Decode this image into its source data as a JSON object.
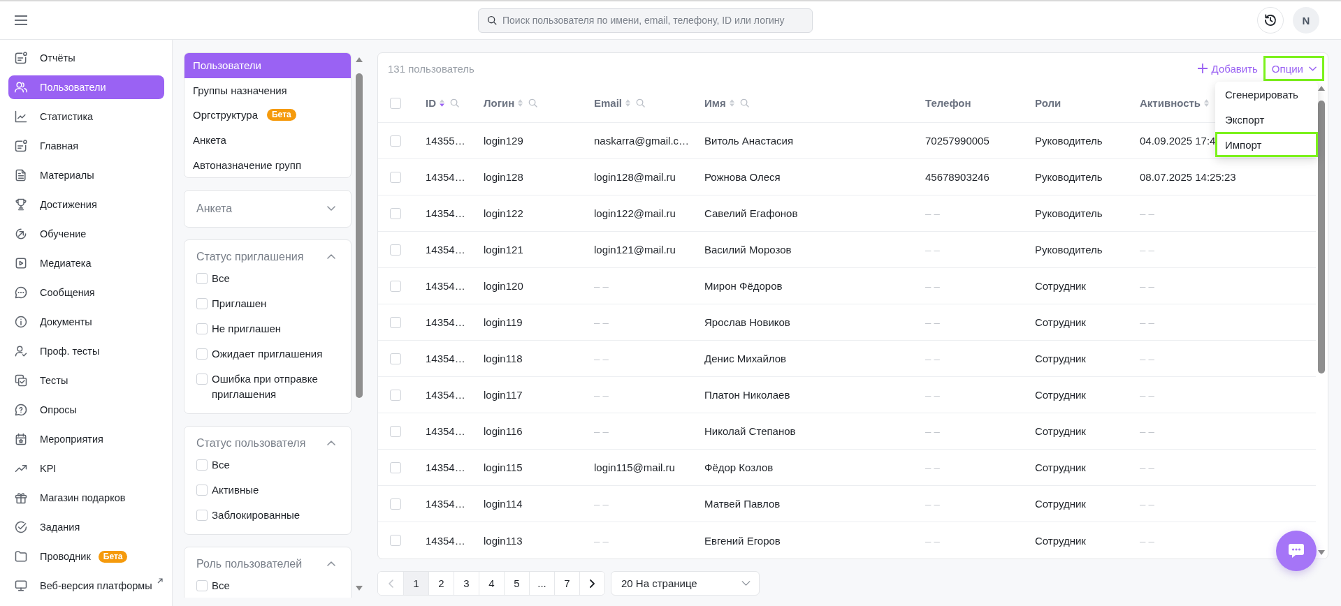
{
  "topbar": {
    "search": {
      "placeholder": "Поиск пользователя по имени, email, телефону, ID или логину"
    },
    "avatar": "N"
  },
  "sidebar": {
    "items": [
      {
        "label": "Отчёты",
        "selected": false
      },
      {
        "label": "Пользователи",
        "selected": true
      },
      {
        "label": "Статистика",
        "selected": false
      },
      {
        "label": "Главная",
        "selected": false
      },
      {
        "label": "Материалы",
        "selected": false
      },
      {
        "label": "Достижения",
        "selected": false
      },
      {
        "label": "Обучение",
        "selected": false
      },
      {
        "label": "Медиатека",
        "selected": false
      },
      {
        "label": "Сообщения",
        "selected": false
      },
      {
        "label": "Документы",
        "selected": false
      },
      {
        "label": "Проф. тесты",
        "selected": false
      },
      {
        "label": "Тесты",
        "selected": false
      },
      {
        "label": "Опросы",
        "selected": false
      },
      {
        "label": "Мероприятия",
        "selected": false
      },
      {
        "label": "KPI",
        "selected": false
      },
      {
        "label": "Магазин подарков",
        "selected": false
      },
      {
        "label": "Задания",
        "selected": false
      },
      {
        "label": "Проводник",
        "selected": false,
        "badge": "Бета"
      },
      {
        "label": "Веб-версия платформы",
        "selected": false,
        "external": true
      }
    ]
  },
  "sections_nav": {
    "items": [
      {
        "label": "Пользователи",
        "selected": true
      },
      {
        "label": "Группы назначения",
        "selected": false
      },
      {
        "label": "Оргструктура",
        "selected": false,
        "badge": "Бета"
      },
      {
        "label": "Анкета",
        "selected": false
      },
      {
        "label": "Автоназначение групп",
        "selected": false
      }
    ]
  },
  "filters": [
    {
      "title": "Анкета",
      "expanded": false
    },
    {
      "title": "Статус приглашения",
      "expanded": true,
      "options": [
        {
          "label": "Все",
          "checked": false
        },
        {
          "label": "Приглашен",
          "checked": false
        },
        {
          "label": "Не приглашен",
          "checked": false
        },
        {
          "label": "Ожидает приглашения",
          "checked": false
        },
        {
          "label": "Ошибка при отправке приглашения",
          "checked": false
        }
      ]
    },
    {
      "title": "Статус пользователя",
      "expanded": true,
      "options": [
        {
          "label": "Все",
          "checked": false
        },
        {
          "label": "Активные",
          "checked": false
        },
        {
          "label": "Заблокированные",
          "checked": false
        }
      ]
    },
    {
      "title": "Роль пользователей",
      "expanded": true,
      "options": [
        {
          "label": "Все",
          "checked": false
        }
      ]
    }
  ],
  "table": {
    "count": "131 пользователь",
    "actions": {
      "add": "Добавить",
      "options": {
        "label": "Опции",
        "highlighted": true,
        "open": true,
        "menu": [
          {
            "label": "Сгенерировать",
            "highlighted": false
          },
          {
            "label": "Экспорт",
            "highlighted": false
          },
          {
            "label": "Импорт",
            "highlighted": true
          }
        ]
      }
    },
    "select_all": {
      "checked": false
    },
    "columns": [
      {
        "label": "ID",
        "sortable": true,
        "sorted": true,
        "search": true
      },
      {
        "label": "Логин",
        "sortable": true,
        "sorted": false,
        "search": true
      },
      {
        "label": "Email",
        "sortable": true,
        "sorted": false,
        "search": true
      },
      {
        "label": "Имя",
        "sortable": true,
        "sorted": false,
        "search": true
      },
      {
        "label": "Телефон",
        "sortable": false,
        "search": false
      },
      {
        "label": "Роли",
        "sortable": false,
        "search": false
      },
      {
        "label": "Активность",
        "sortable": true,
        "sorted": false,
        "search": false
      }
    ],
    "rows": [
      {
        "checked": false,
        "cells": [
          "14355…",
          "login129",
          "naskarra@gmail.c…",
          "Витоль Анастасия",
          "70257990005",
          "Руководитель",
          "04.09.2025 17:4"
        ]
      },
      {
        "checked": false,
        "cells": [
          "14354…",
          "login128",
          "login128@mail.ru",
          "Рожнова Олеся",
          "45678903246",
          "Руководитель",
          "08.07.2025 14:25:23"
        ]
      },
      {
        "checked": false,
        "cells": [
          "14354…",
          "login122",
          "login122@mail.ru",
          "Савелий Егафонов",
          {
            "text": "– –",
            "muted": true
          },
          "Руководитель",
          {
            "text": "– –",
            "muted": true
          }
        ]
      },
      {
        "checked": false,
        "cells": [
          "14354…",
          "login121",
          "login121@mail.ru",
          "Василий Морозов",
          {
            "text": "– –",
            "muted": true
          },
          "Руководитель",
          {
            "text": "– –",
            "muted": true
          }
        ]
      },
      {
        "checked": false,
        "cells": [
          "14354…",
          "login120",
          {
            "text": "– –",
            "muted": true
          },
          "Мирон Фёдоров",
          {
            "text": "– –",
            "muted": true
          },
          "Сотрудник",
          {
            "text": "– –",
            "muted": true
          }
        ]
      },
      {
        "checked": false,
        "cells": [
          "14354…",
          "login119",
          {
            "text": "– –",
            "muted": true
          },
          "Ярослав Новиков",
          {
            "text": "– –",
            "muted": true
          },
          "Сотрудник",
          {
            "text": "– –",
            "muted": true
          }
        ]
      },
      {
        "checked": false,
        "cells": [
          "14354…",
          "login118",
          {
            "text": "– –",
            "muted": true
          },
          "Денис Михайлов",
          {
            "text": "– –",
            "muted": true
          },
          "Сотрудник",
          {
            "text": "– –",
            "muted": true
          }
        ]
      },
      {
        "checked": false,
        "cells": [
          "14354…",
          "login117",
          {
            "text": "– –",
            "muted": true
          },
          "Платон Николаев",
          {
            "text": "– –",
            "muted": true
          },
          "Сотрудник",
          {
            "text": "– –",
            "muted": true
          }
        ]
      },
      {
        "checked": false,
        "cells": [
          "14354…",
          "login116",
          {
            "text": "– –",
            "muted": true
          },
          "Николай Степанов",
          {
            "text": "– –",
            "muted": true
          },
          "Сотрудник",
          {
            "text": "– –",
            "muted": true
          }
        ]
      },
      {
        "checked": false,
        "cells": [
          "14354…",
          "login115",
          "login115@mail.ru",
          "Фёдор Козлов",
          {
            "text": "– –",
            "muted": true
          },
          "Сотрудник",
          {
            "text": "– –",
            "muted": true
          }
        ]
      },
      {
        "checked": false,
        "cells": [
          "14354…",
          "login114",
          {
            "text": "– –",
            "muted": true
          },
          "Матвей Павлов",
          {
            "text": "– –",
            "muted": true
          },
          "Сотрудник",
          {
            "text": "– –",
            "muted": true
          }
        ]
      },
      {
        "checked": false,
        "cells": [
          "14354…",
          "login113",
          {
            "text": "– –",
            "muted": true
          },
          "Евгений Егоров",
          {
            "text": "– –",
            "muted": true
          },
          "Сотрудник",
          {
            "text": "– –",
            "muted": true
          }
        ]
      }
    ]
  },
  "pagination": {
    "prev_disabled": true,
    "pages": [
      {
        "label": "1",
        "selected": true
      },
      {
        "label": "2",
        "selected": false
      },
      {
        "label": "3",
        "selected": false
      },
      {
        "label": "4",
        "selected": false
      },
      {
        "label": "5",
        "selected": false
      },
      {
        "label": "...",
        "selected": false
      },
      {
        "label": "7",
        "selected": false
      }
    ],
    "next_disabled": false,
    "per_page": "20 На странице"
  }
}
